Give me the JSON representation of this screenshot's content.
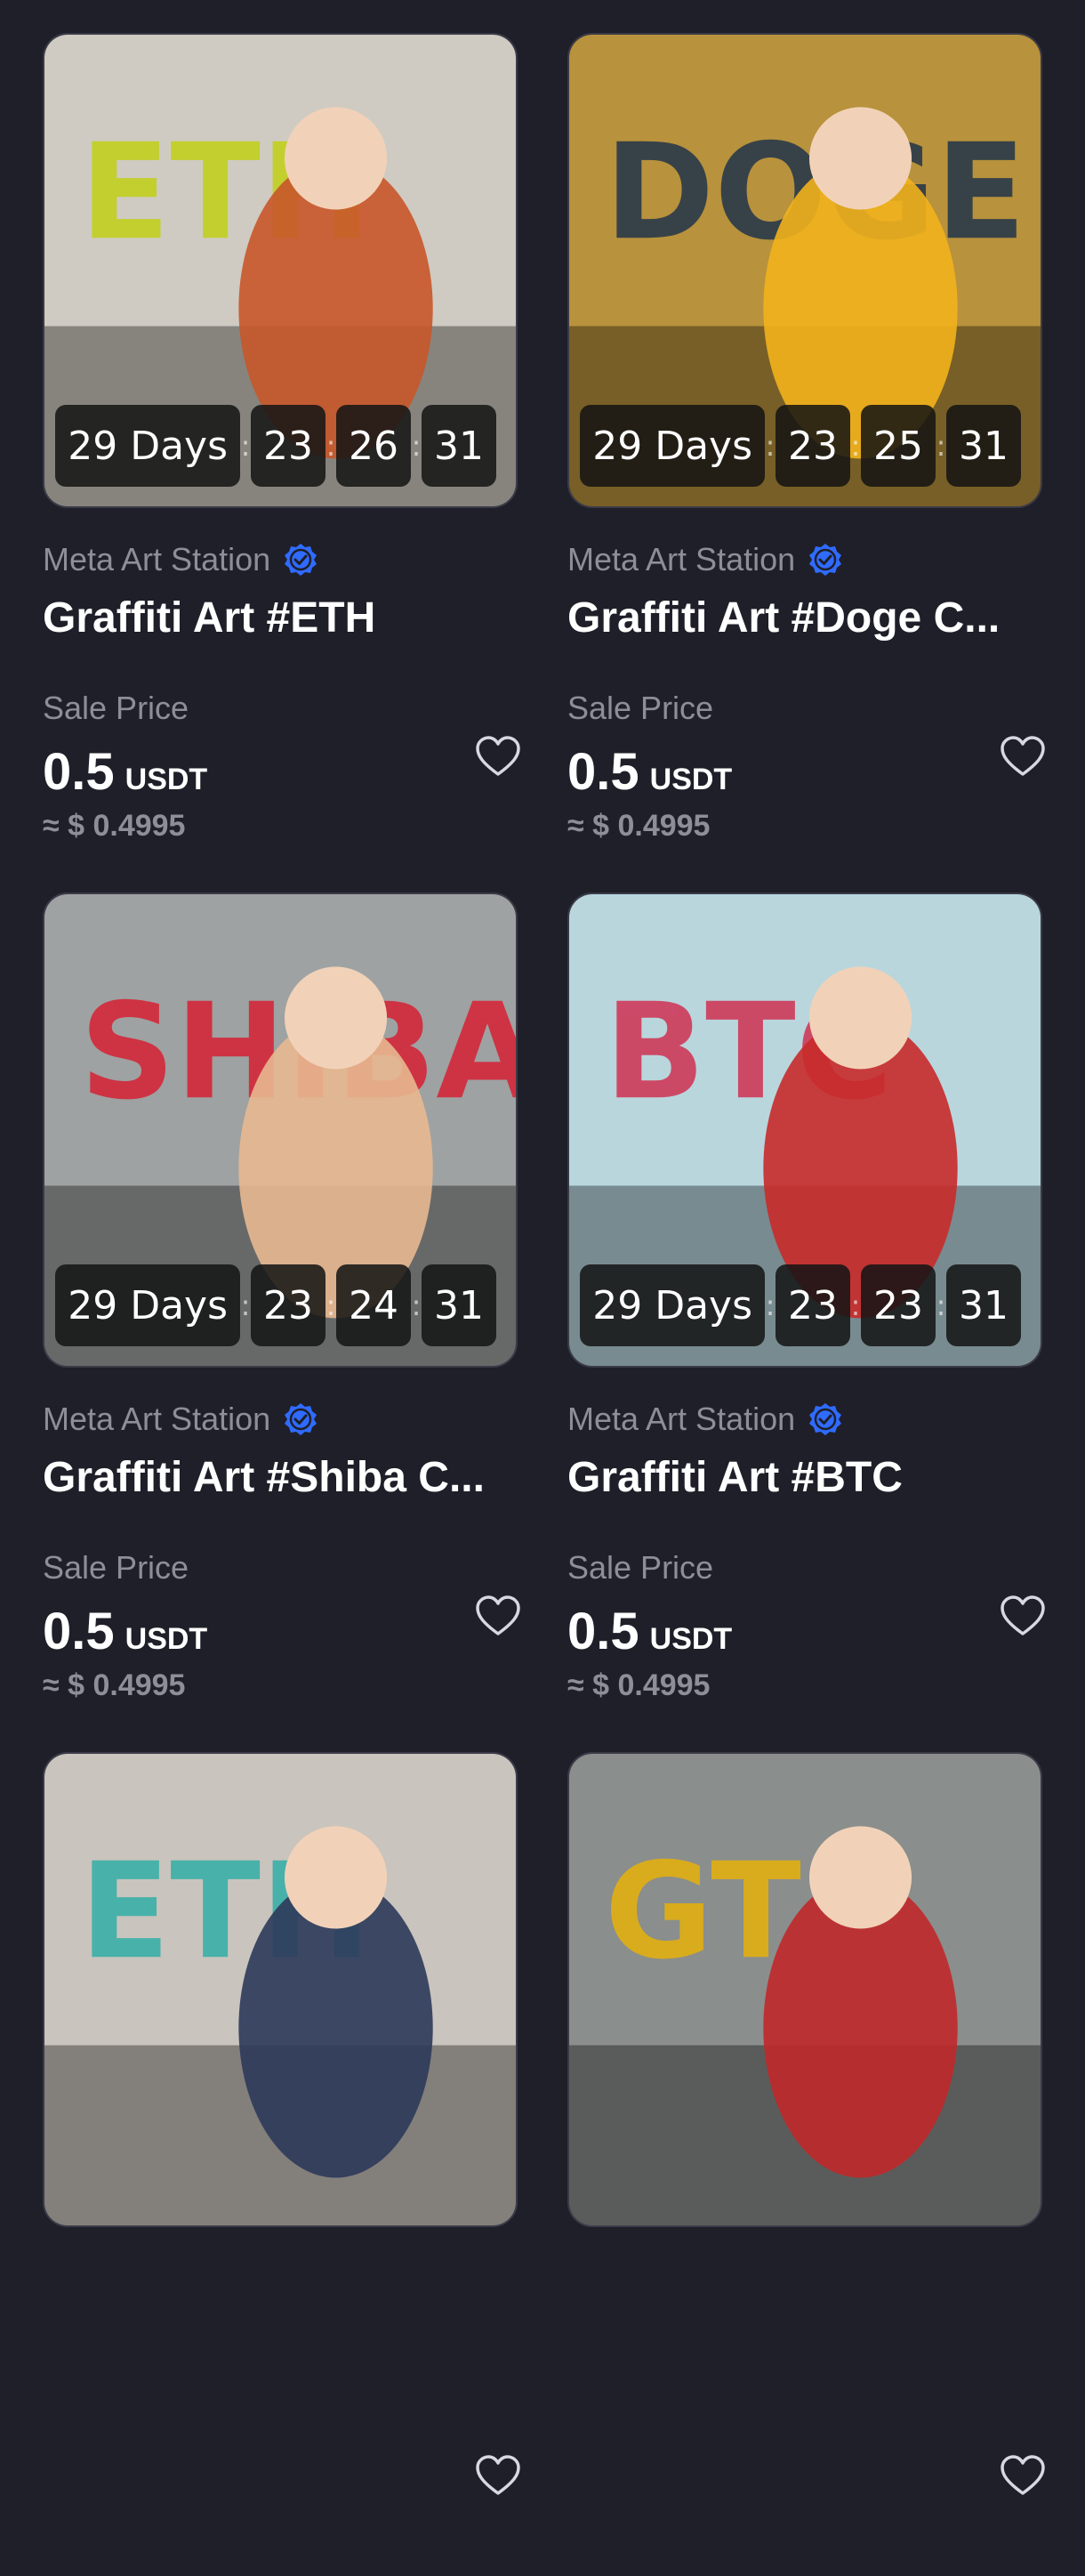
{
  "cards": [
    {
      "days": "29 Days",
      "hours": "23",
      "minutes": "26",
      "seconds": "31",
      "creator": "Meta Art Station",
      "title": "Graffiti Art #ETH",
      "sale_label": "Sale Price",
      "price": "0.5",
      "unit": "USDT",
      "usd": "≈ $ 0.4995",
      "art_text": "ETH",
      "art_colors": {
        "bg": "#cfcbc2",
        "accent": "#c2d01f",
        "figure": "#c8562a"
      }
    },
    {
      "days": "29 Days",
      "hours": "23",
      "minutes": "25",
      "seconds": "31",
      "creator": "Meta Art Station",
      "title": "Graffiti Art #Doge C...",
      "sale_label": "Sale Price",
      "price": "0.5",
      "unit": "USDT",
      "usd": "≈ $ 0.4995",
      "art_text": "DOGE",
      "art_colors": {
        "bg": "#b8923c",
        "accent": "#2a3a4a",
        "figure": "#f2b21c"
      }
    },
    {
      "days": "29 Days",
      "hours": "23",
      "minutes": "24",
      "seconds": "31",
      "creator": "Meta Art Station",
      "title": "Graffiti Art #Shiba C...",
      "sale_label": "Sale Price",
      "price": "0.5",
      "unit": "USDT",
      "usd": "≈ $ 0.4995",
      "art_text": "SHIBA",
      "art_colors": {
        "bg": "#9ea2a2",
        "accent": "#d4283a",
        "figure": "#e8b890"
      }
    },
    {
      "days": "29 Days",
      "hours": "23",
      "minutes": "23",
      "seconds": "31",
      "creator": "Meta Art Station",
      "title": "Graffiti Art #BTC",
      "sale_label": "Sale Price",
      "price": "0.5",
      "unit": "USDT",
      "usd": "≈ $ 0.4995",
      "art_text": "BTC",
      "art_colors": {
        "bg": "#b9d6dd",
        "accent": "#cf3a5a",
        "figure": "#c82a2a"
      }
    },
    {
      "days": "",
      "hours": "",
      "minutes": "",
      "seconds": "",
      "creator": "",
      "title": "",
      "sale_label": "",
      "price": "",
      "unit": "",
      "usd": "",
      "art_text": "ETH",
      "art_colors": {
        "bg": "#c9c4bd",
        "accent": "#3bb0a8",
        "figure": "#2c3a5a"
      }
    },
    {
      "days": "",
      "hours": "",
      "minutes": "",
      "seconds": "",
      "creator": "",
      "title": "",
      "sale_label": "",
      "price": "",
      "unit": "",
      "usd": "",
      "art_text": "GT",
      "art_colors": {
        "bg": "#8a8e8c",
        "accent": "#e2b012",
        "figure": "#c0282a"
      }
    }
  ],
  "colors": {
    "background": "#1f1f29",
    "muted": "#8e8e9a",
    "verified": "#2f6bff"
  }
}
